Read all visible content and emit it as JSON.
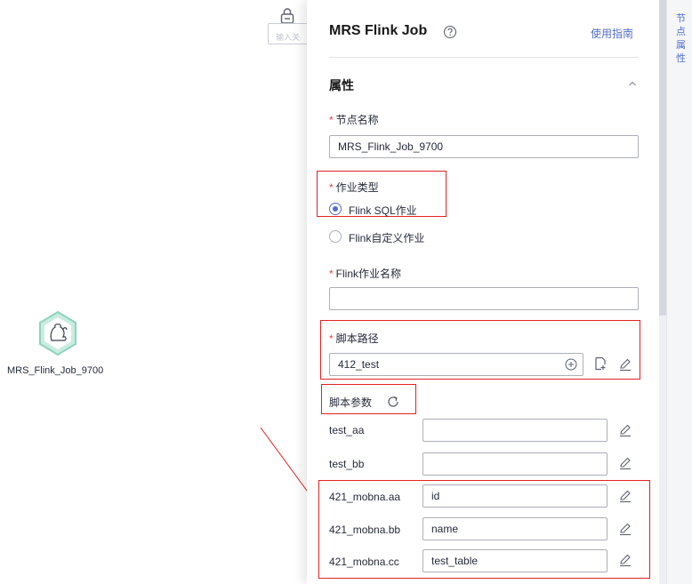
{
  "canvas": {
    "input_fragment": "输入关",
    "node_label": "MRS_Flink_Job_9700"
  },
  "panel": {
    "title": "MRS Flink Job",
    "guide_link": "使用指南",
    "section_title": "属性",
    "node_name": {
      "label": "节点名称",
      "value": "MRS_Flink_Job_9700"
    },
    "job_type": {
      "label": "作业类型",
      "options": [
        {
          "label": "Flink SQL作业",
          "checked": true
        },
        {
          "label": "Flink自定义作业",
          "checked": false
        }
      ]
    },
    "flink_job_name": {
      "label": "Flink作业名称",
      "value": ""
    },
    "script_path": {
      "label": "脚本路径",
      "value": "412_test"
    },
    "script_params": {
      "label": "脚本参数",
      "rows": [
        {
          "name": "test_aa",
          "value": ""
        },
        {
          "name": "test_bb",
          "value": ""
        },
        {
          "name": "421_mobna.aa",
          "value": "id"
        },
        {
          "name": "421_mobna.bb",
          "value": "name"
        },
        {
          "name": "421_mobna.cc",
          "value": "test_table"
        }
      ]
    }
  },
  "right_sidebar": {
    "tab_label": "节点属性"
  },
  "colors": {
    "accent": "#526ecc",
    "required": "#e54545",
    "highlight_box": "#e32222",
    "node_icon": "#8fd3be"
  }
}
